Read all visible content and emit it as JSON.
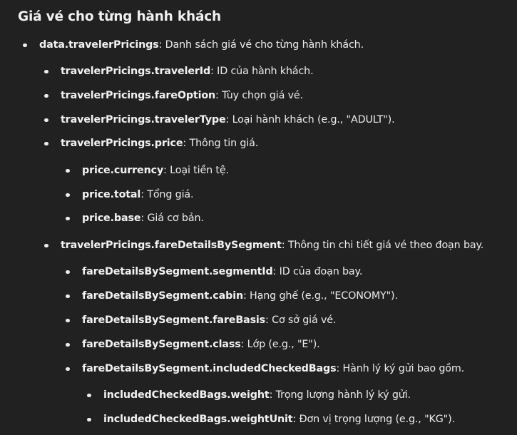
{
  "heading": "Giá vé cho từng hành khách",
  "items": [
    {
      "key": "data.travelerPricings",
      "desc": ": Danh sách giá vé cho từng hành khách."
    },
    {
      "key": "travelerPricings.travelerId",
      "desc": ": ID của hành khách."
    },
    {
      "key": "travelerPricings.fareOption",
      "desc": ": Tùy chọn giá vé."
    },
    {
      "key": "travelerPricings.travelerType",
      "desc": ": Loại hành khách (e.g., \"ADULT\")."
    },
    {
      "key": "travelerPricings.price",
      "desc": ": Thông tin giá."
    },
    {
      "key": "price.currency",
      "desc": ": Loại tiền tệ."
    },
    {
      "key": "price.total",
      "desc": ": Tổng giá."
    },
    {
      "key": "price.base",
      "desc": ": Giá cơ bản."
    },
    {
      "key": "travelerPricings.fareDetailsBySegment",
      "desc": ": Thông tin chi tiết giá vé theo đoạn bay."
    },
    {
      "key": "fareDetailsBySegment.segmentId",
      "desc": ": ID của đoạn bay."
    },
    {
      "key": "fareDetailsBySegment.cabin",
      "desc": ": Hạng ghế (e.g., \"ECONOMY\")."
    },
    {
      "key": "fareDetailsBySegment.fareBasis",
      "desc": ": Cơ sở giá vé."
    },
    {
      "key": "fareDetailsBySegment.class",
      "desc": ": Lớp (e.g., \"E\")."
    },
    {
      "key": "fareDetailsBySegment.includedCheckedBags",
      "desc": ": Hành lý ký gửi bao gồm."
    },
    {
      "key": "includedCheckedBags.weight",
      "desc": ": Trọng lượng hành lý ký gửi."
    },
    {
      "key": "includedCheckedBags.weightUnit",
      "desc": ": Đơn vị trọng lượng (e.g., \"KG\")."
    }
  ]
}
